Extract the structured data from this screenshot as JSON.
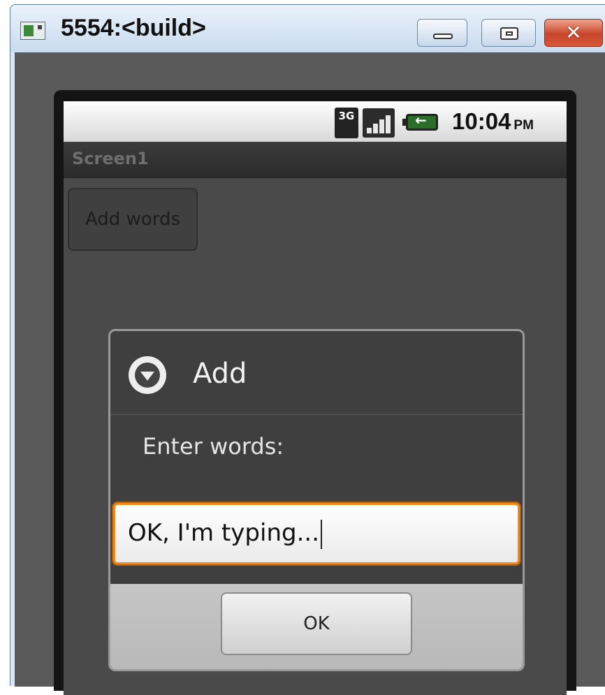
{
  "window": {
    "title": "5554:<build>",
    "controls": {
      "close_glyph": "✕"
    }
  },
  "status_bar": {
    "network_badge": "3G",
    "time": "10:04",
    "ampm": "PM"
  },
  "app": {
    "title": "Screen1",
    "add_words_button": "Add words"
  },
  "dialog": {
    "title": "Add",
    "message": "Enter words:",
    "input_value": "OK, I'm typing...",
    "ok_label": "OK"
  },
  "colors": {
    "input_focus": "#f08a1a",
    "window_close": "#c8452a"
  },
  "icons": {
    "dialog_icon": "chevron-down-circle-icon",
    "battery": "battery-charging-icon",
    "signal": "signal-bars-icon"
  }
}
